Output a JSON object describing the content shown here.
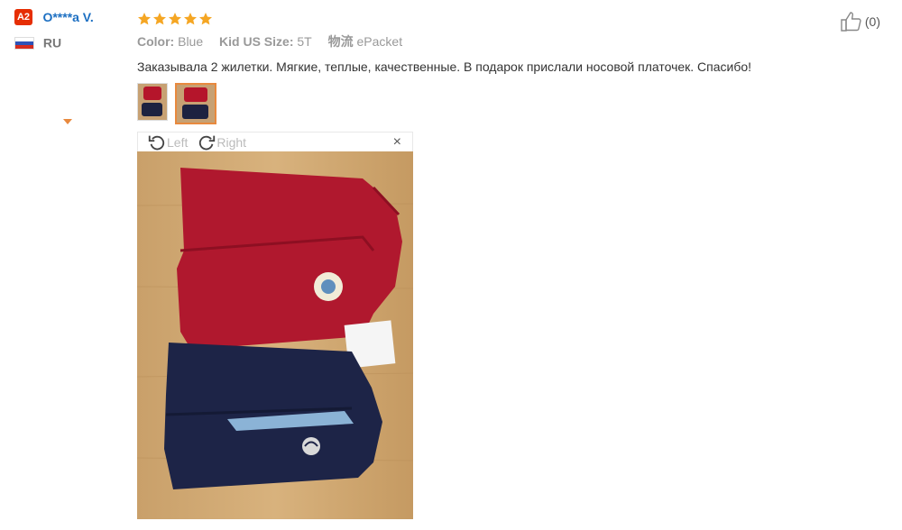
{
  "reviewer": {
    "badge": "A2",
    "name": "O****a V.",
    "country_code": "RU"
  },
  "rating": {
    "stars": 5,
    "color": "#f5a623"
  },
  "attributes": {
    "color_label": "Color:",
    "color_value": "Blue",
    "size_label": "Kid US Size:",
    "size_value": "5T",
    "shipping_label": "物流",
    "shipping_value": "ePacket"
  },
  "review_text": "Заказывала 2 жилетки. Мягкие, теплые, качественные. В подарок прислали носовой платочек. Спасибо!",
  "helpful": {
    "count_text": "(0)"
  },
  "viewer": {
    "rotate_left_label": "Left",
    "rotate_right_label": "Right",
    "close_label": "×"
  },
  "colors": {
    "accent": "#e8893e",
    "link": "#1c6fc2",
    "badge": "#e62e04"
  },
  "icons": [
    "thumbs-up-icon",
    "rotate-left-icon",
    "rotate-right-icon",
    "close-icon",
    "star-icon",
    "flag-ru-icon"
  ]
}
